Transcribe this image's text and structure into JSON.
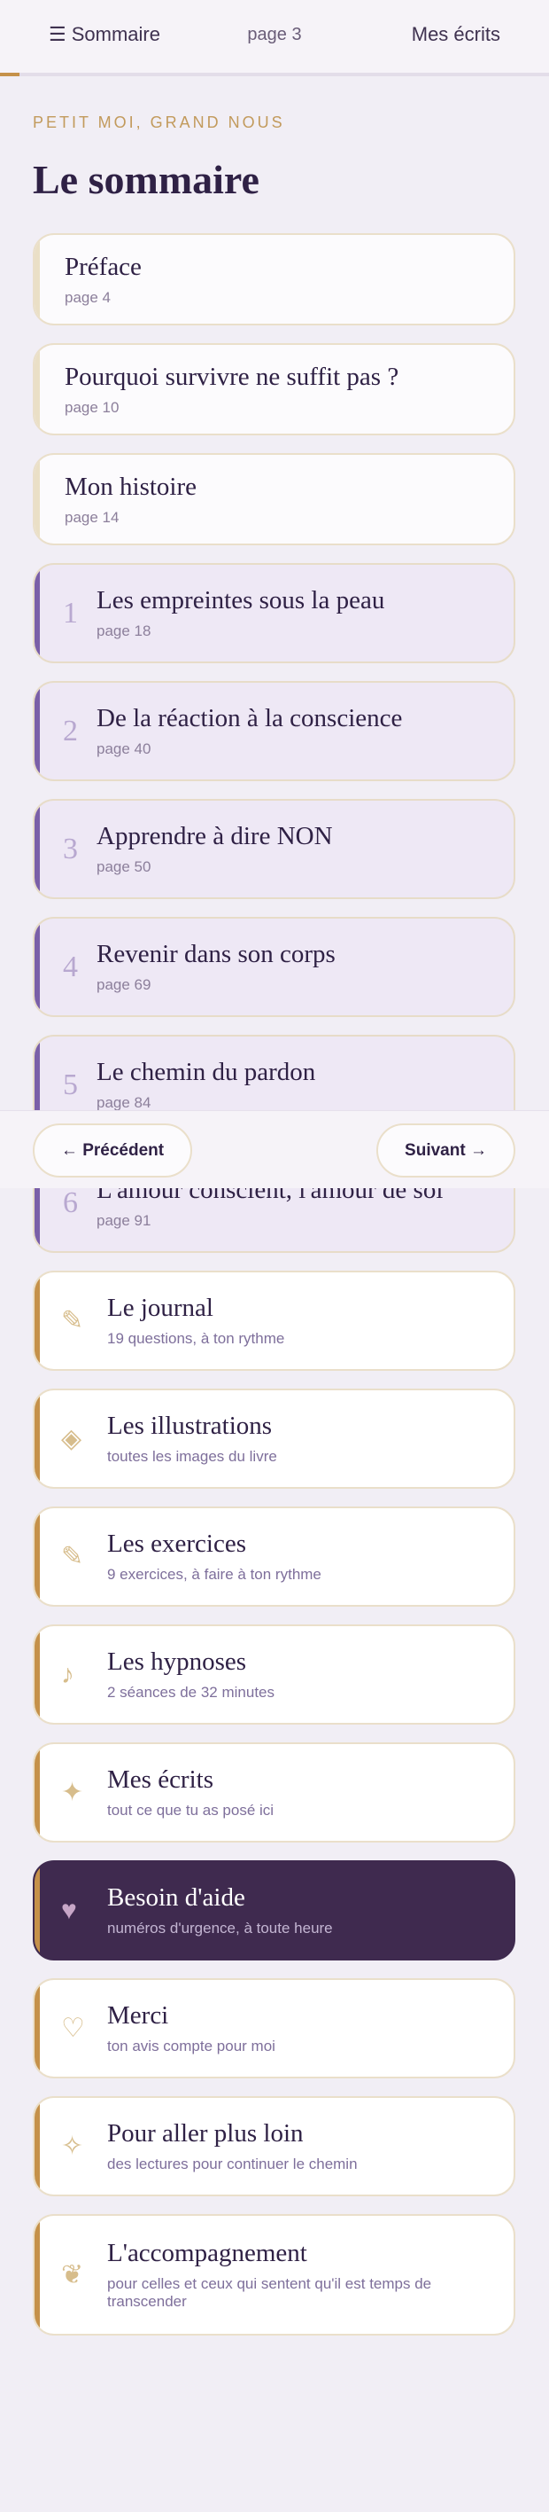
{
  "topbar": {
    "menu_icon": "☰",
    "menu_label": "Sommaire",
    "page_label": "page 3",
    "writings_label": "Mes écrits",
    "accent": "#c5914a"
  },
  "header": {
    "eyebrow": "PETIT MOI, GRAND NOUS",
    "title": "Le sommaire"
  },
  "front_matter": [
    {
      "title": "Préface",
      "page": "page 4"
    },
    {
      "title": "Pourquoi survivre ne suffit pas ?",
      "page": "page 10"
    },
    {
      "title": "Mon histoire",
      "page": "page 14"
    }
  ],
  "chapters": [
    {
      "num": "1",
      "title": "Les empreintes sous la peau",
      "page": "page 18"
    },
    {
      "num": "2",
      "title": "De la réaction à la conscience",
      "page": "page 40"
    },
    {
      "num": "3",
      "title": "Apprendre à dire NON",
      "page": "page 50"
    },
    {
      "num": "4",
      "title": "Revenir dans son corps",
      "page": "page 69"
    },
    {
      "num": "5",
      "title": "Le chemin du pardon",
      "page": "page 84"
    },
    {
      "num": "6",
      "title": "L'amour conscient, l'amour de soi",
      "page": "page 91"
    }
  ],
  "tools": [
    {
      "icon": "✎",
      "icon_name": "pencil-icon",
      "title": "Le journal",
      "sub": "19 questions, à ton rythme"
    },
    {
      "icon": "◈",
      "icon_name": "diamond-icon",
      "title": "Les illustrations",
      "sub": "toutes les images du livre"
    },
    {
      "icon": "✎",
      "icon_name": "pencil-icon",
      "title": "Les exercices",
      "sub": "9 exercices, à faire à ton rythme"
    },
    {
      "icon": "♪",
      "icon_name": "music-note-icon",
      "title": "Les hypnoses",
      "sub": "2 séances de 32 minutes"
    },
    {
      "icon": "✦",
      "icon_name": "sparkle-icon",
      "title": "Mes écrits",
      "sub": "tout ce que tu as posé ici"
    },
    {
      "icon": "♥",
      "icon_name": "heart-icon",
      "title": "Besoin d'aide",
      "sub": "numéros d'urgence, à toute heure"
    },
    {
      "icon": "♡",
      "icon_name": "heart-outline-icon",
      "title": "Merci",
      "sub": "ton avis compte pour moi"
    },
    {
      "icon": "✧",
      "icon_name": "star-outline-icon",
      "title": "Pour aller plus loin",
      "sub": "des lectures pour continuer le chemin"
    },
    {
      "icon": "❦",
      "icon_name": "floral-heart-icon",
      "title": "L'accompagnement",
      "sub": "pour celles et ceux qui sentent qu'il est temps de transcender"
    }
  ],
  "pager": {
    "prev_label": "← Précédent",
    "next_label": "Suivant →"
  }
}
